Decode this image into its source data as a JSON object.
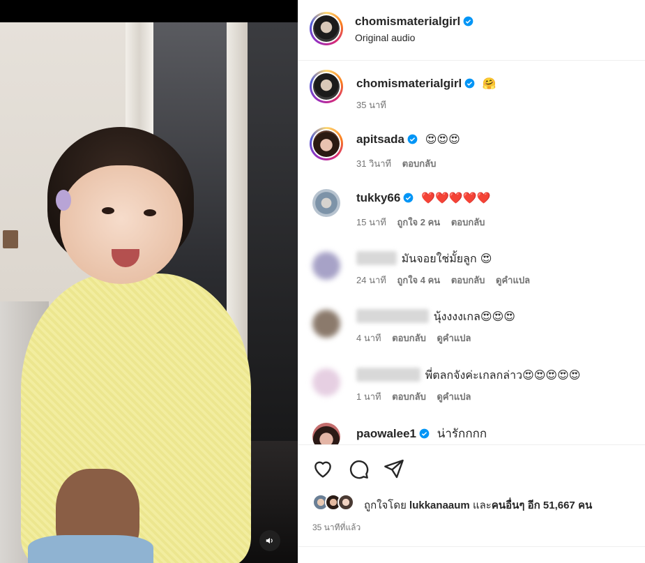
{
  "post": {
    "username": "chomismaterialgirl",
    "audio": "Original audio"
  },
  "comments": [
    {
      "username": "chomismaterialgirl",
      "text": "🤗",
      "time": "35 นาที",
      "likes": "",
      "reply": "",
      "translate": ""
    },
    {
      "username": "apitsada",
      "text": "😍😍😍",
      "time": "31 วินาที",
      "likes": "",
      "reply": "ตอบกลับ",
      "translate": ""
    },
    {
      "username": "tukky66",
      "text": "❤️❤️❤️❤️❤️",
      "time": "15 นาที",
      "likes": "ถูกใจ 2 คน",
      "reply": "ตอบกลับ",
      "translate": ""
    },
    {
      "username": "",
      "text": "มันจอยใช่มั้ยลูก 😍",
      "time": "24 นาที",
      "likes": "ถูกใจ 4 คน",
      "reply": "ตอบกลับ",
      "translate": "ดูคำแปล"
    },
    {
      "username": "",
      "text": "นุ้งงงงเกล😍😍😍",
      "time": "4 นาที",
      "likes": "",
      "reply": "ตอบกลับ",
      "translate": "ดูคำแปล"
    },
    {
      "username": "",
      "text": "พี่ตลกจังค่ะเกลกล่าว😍😍😍😍😍",
      "time": "1 นาที",
      "likes": "",
      "reply": "ตอบกลับ",
      "translate": "ดูคำแปล"
    },
    {
      "username": "paowalee1",
      "text": "น่ารักกกก",
      "time": "",
      "likes": "",
      "reply": "",
      "translate": ""
    }
  ],
  "likes_summary": {
    "prefix": "ถูกใจโดย",
    "user": "lukkanaaum",
    "and": "และ",
    "others": "คนอื่นๆ อีก 51,667 คน"
  },
  "posted_ago": "35 นาทีที่แล้ว",
  "icons": {
    "like": "heart-icon",
    "comment": "comment-icon",
    "share": "share-icon",
    "mute": "speaker-icon",
    "verified": "verified-badge-icon"
  },
  "colors": {
    "verified": "#0095f6",
    "heart_red": "#ed4956",
    "muted_text": "#737373"
  }
}
